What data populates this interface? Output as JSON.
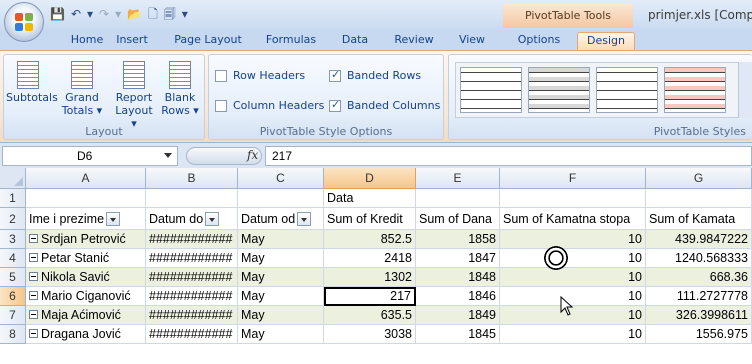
{
  "window": {
    "title": "primjer.xls [Comp",
    "context_tab_group": "PivotTable Tools"
  },
  "tabs": [
    "Home",
    "Insert",
    "Page Layout",
    "Formulas",
    "Data",
    "Review",
    "View",
    "Options",
    "Design"
  ],
  "active_tab": "Design",
  "ribbon": {
    "layout_group": {
      "label": "Layout",
      "buttons": [
        {
          "line1": "Subtotals",
          "line2": ""
        },
        {
          "line1": "Grand",
          "line2": "Totals ▾"
        },
        {
          "line1": "Report",
          "line2": "Layout ▾"
        },
        {
          "line1": "Blank",
          "line2": "Rows ▾"
        }
      ]
    },
    "style_options_group": {
      "label": "PivotTable Style Options",
      "row_headers": {
        "label": "Row Headers",
        "checked": false
      },
      "column_headers": {
        "label": "Column Headers",
        "checked": false
      },
      "banded_rows": {
        "label": "Banded Rows",
        "checked": true
      },
      "banded_columns": {
        "label": "Banded Columns",
        "checked": true
      }
    },
    "styles_group": {
      "label": "PivotTable Styles"
    }
  },
  "formula_bar": {
    "name_box": "D6",
    "fx": "fx",
    "value": "217"
  },
  "columns": [
    "A",
    "B",
    "C",
    "D",
    "E",
    "F",
    "G"
  ],
  "rows": [
    "1",
    "2",
    "3",
    "4",
    "5",
    "6",
    "7",
    "8"
  ],
  "selected_column": "D",
  "selected_row": "6",
  "sheet": {
    "row1": {
      "d": "Data"
    },
    "header": [
      "Ime i prezime",
      "Datum do",
      "Datum od",
      "Sum of Kredit",
      "Sum of Dana",
      "Sum of Kamatna stopa",
      "Sum of Kamata"
    ],
    "records": [
      [
        "Srdjan Petrović",
        "############",
        "May",
        "852.5",
        "1858",
        "10",
        "439.9847222"
      ],
      [
        "Petar Stanić",
        "############",
        "May",
        "2418",
        "1847",
        "10",
        "1240.568333"
      ],
      [
        "Nikola Savić",
        "############",
        "May",
        "1302",
        "1848",
        "10",
        "668.36"
      ],
      [
        "Mario Ciganović",
        "############",
        "May",
        "217",
        "1846",
        "10",
        "111.2727778"
      ],
      [
        "Maja Aćimović",
        "############",
        "May",
        "635.5",
        "1849",
        "10",
        "326.3998611"
      ],
      [
        "Dragana Jović",
        "############",
        "May",
        "3038",
        "1845",
        "10",
        "1556.975"
      ]
    ]
  },
  "colors": {
    "band": "#ebf1de",
    "context_tab": "#f4c7a2",
    "selection_header": "#f5c58a"
  }
}
